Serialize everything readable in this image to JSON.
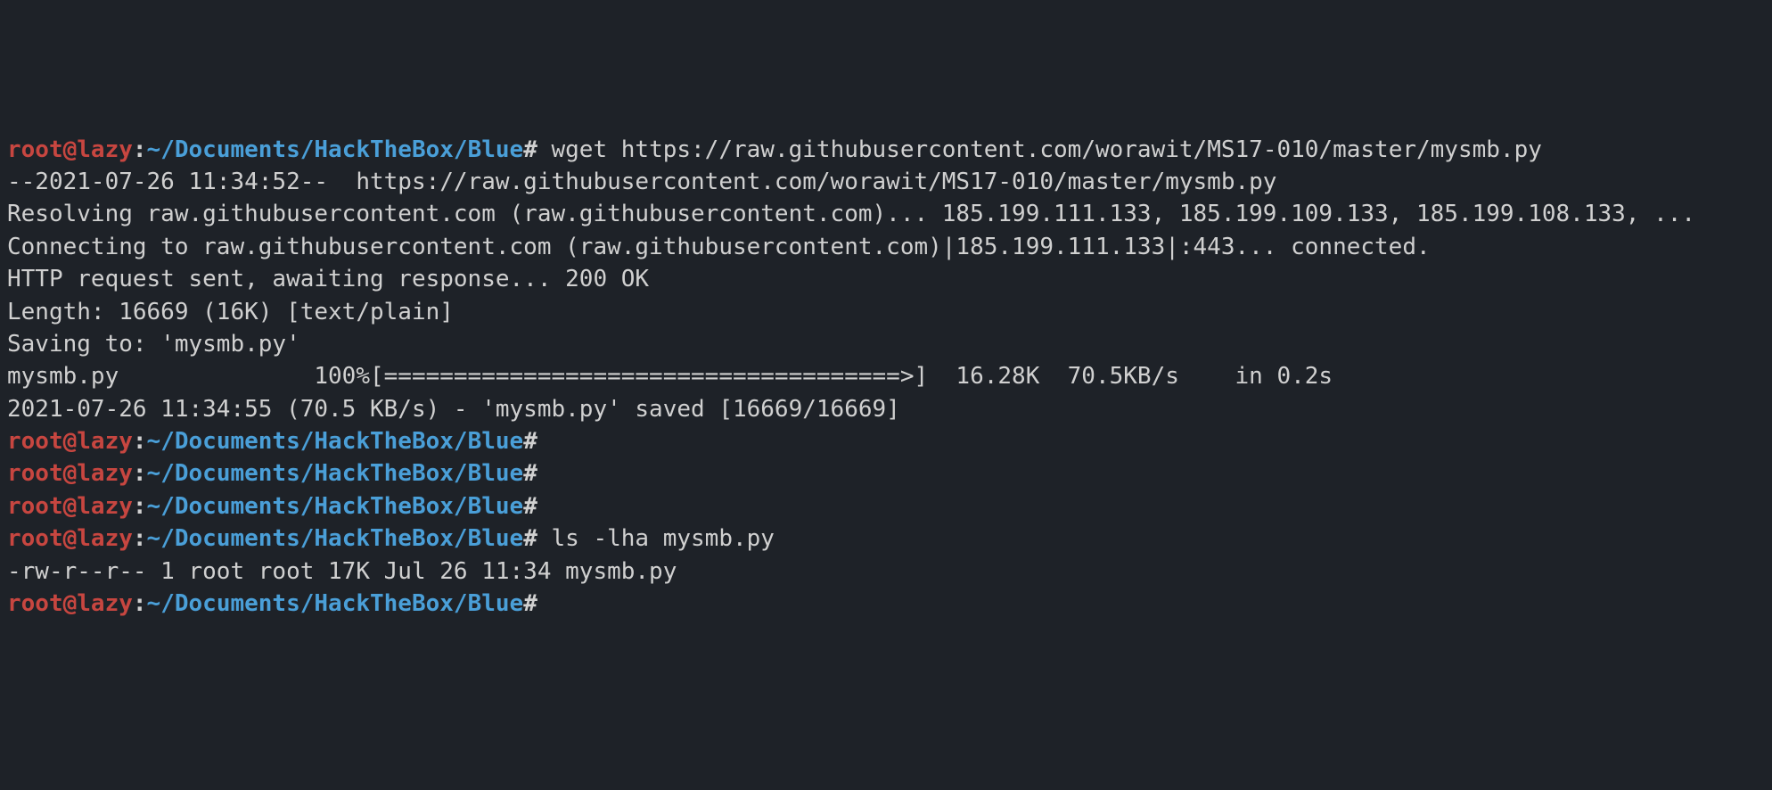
{
  "prompt": {
    "user": "root@lazy",
    "colon": ":",
    "path": "~/Documents/HackTheBox/Blue",
    "hash": "#"
  },
  "cmd1": " wget https://raw.githubusercontent.com/worawit/MS17-010/master/mysmb.py",
  "out": {
    "l1": "--2021-07-26 11:34:52--  https://raw.githubusercontent.com/worawit/MS17-010/master/mysmb.py",
    "l2": "Resolving raw.githubusercontent.com (raw.githubusercontent.com)... 185.199.111.133, 185.199.109.133, 185.199.108.133, ...",
    "l3": "Connecting to raw.githubusercontent.com (raw.githubusercontent.com)|185.199.111.133|:443... connected.",
    "l4": "HTTP request sent, awaiting response... 200 OK",
    "l5": "Length: 16669 (16K) [text/plain]",
    "l6": "Saving to: 'mysmb.py'",
    "l7": "",
    "l8": "mysmb.py              100%[=====================================>]  16.28K  70.5KB/s    in 0.2s",
    "l9": "",
    "l10": "2021-07-26 11:34:55 (70.5 KB/s) - 'mysmb.py' saved [16669/16669]",
    "l11": ""
  },
  "cmd2": " ",
  "cmd3": " ",
  "cmd4": " ",
  "cmd5": " ls -lha mysmb.py",
  "out2": "-rw-r--r-- 1 root root 17K Jul 26 11:34 mysmb.py",
  "cmd6": " "
}
